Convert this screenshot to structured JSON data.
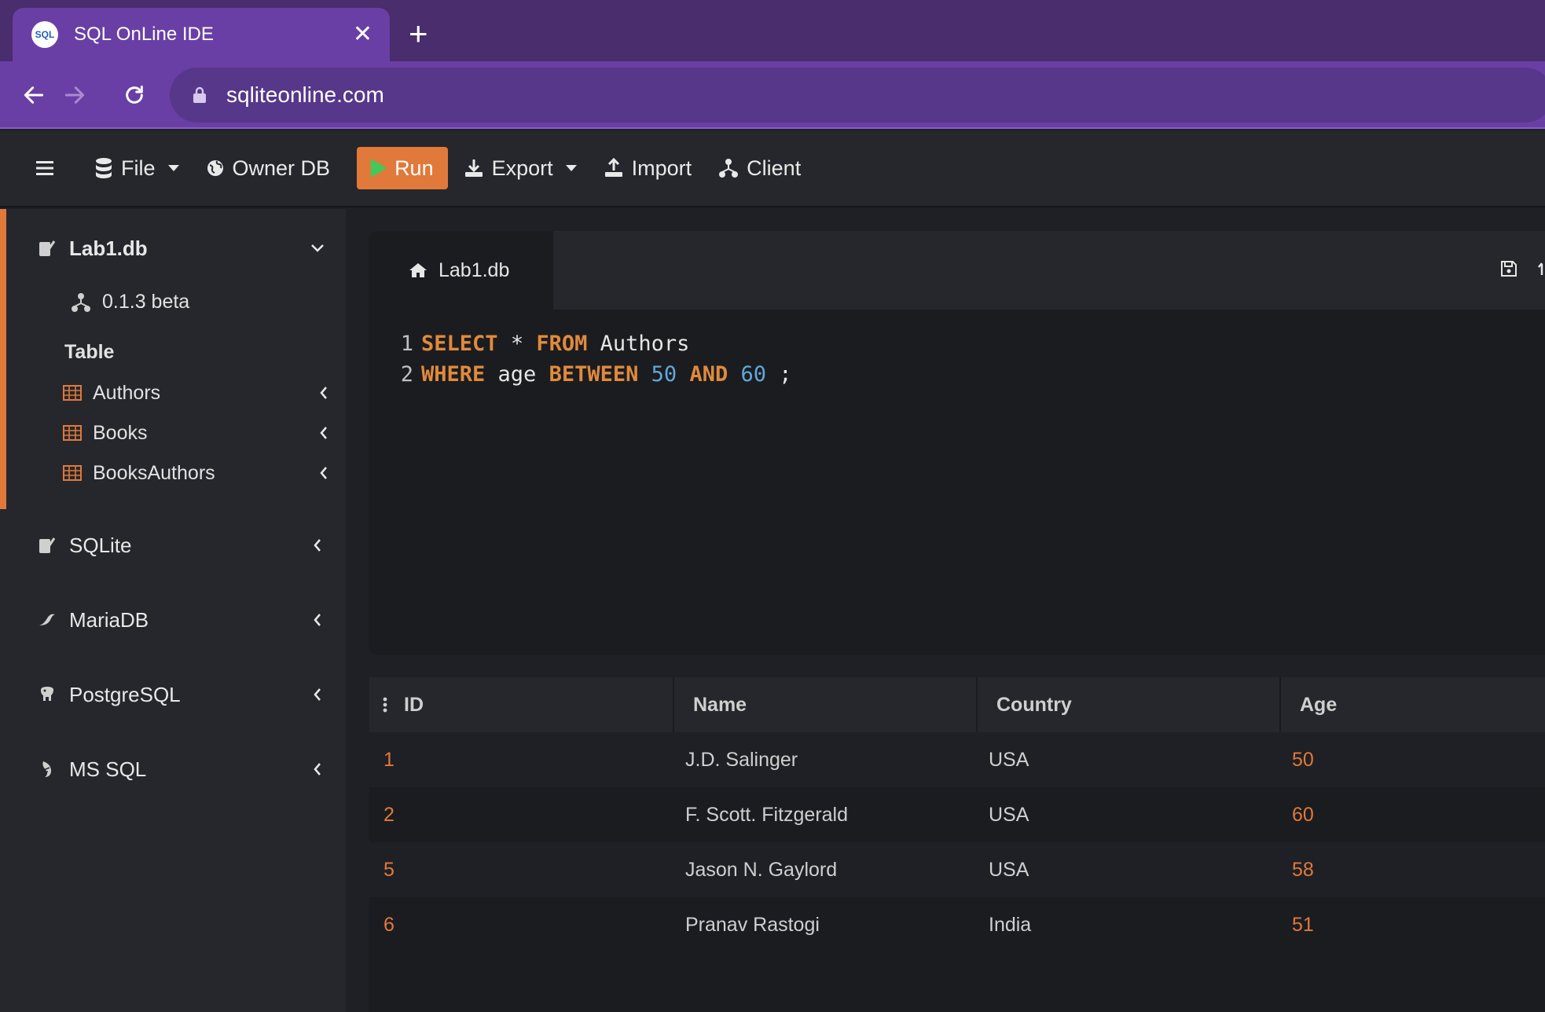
{
  "browser": {
    "tab_title": "SQL OnLine IDE",
    "favicon_text": "SQL",
    "url": "sqliteonline.com"
  },
  "toolbar": {
    "file_label": "File",
    "owner_db_label": "Owner DB",
    "run_label": "Run",
    "export_label": "Export",
    "import_label": "Import",
    "client_label": "Client"
  },
  "sidebar": {
    "current_db": "Lab1.db",
    "version": "0.1.3 beta",
    "table_heading": "Table",
    "tables": [
      "Authors",
      "Books",
      "BooksAuthors"
    ],
    "databases": [
      "SQLite",
      "MariaDB",
      "PostgreSQL",
      "MS SQL"
    ]
  },
  "editor": {
    "tab_label": "Lab1.db",
    "line_numbers": [
      "1",
      "2"
    ],
    "line1": {
      "kw1": "SELECT",
      "star": "*",
      "kw2": "FROM",
      "table": "Authors"
    },
    "line2": {
      "kw1": "WHERE",
      "col": "age",
      "kw2": "BETWEEN",
      "n1": "50",
      "kw3": "AND",
      "n2": "60",
      "semi": ";"
    }
  },
  "results": {
    "columns": [
      "ID",
      "Name",
      "Country",
      "Age"
    ],
    "rows": [
      {
        "id": "1",
        "name": "J.D. Salinger",
        "country": "USA",
        "age": "50"
      },
      {
        "id": "2",
        "name": "F. Scott. Fitzgerald",
        "country": "USA",
        "age": "60"
      },
      {
        "id": "5",
        "name": "Jason N. Gaylord",
        "country": "USA",
        "age": "58"
      },
      {
        "id": "6",
        "name": "Pranav Rastogi",
        "country": "India",
        "age": "51"
      }
    ]
  },
  "colors": {
    "accent": "#e0793a",
    "browser_purple": "#6a3fa5",
    "keyword": "#e08a3c",
    "number": "#62a8d8",
    "run_play": "#42c95a"
  }
}
